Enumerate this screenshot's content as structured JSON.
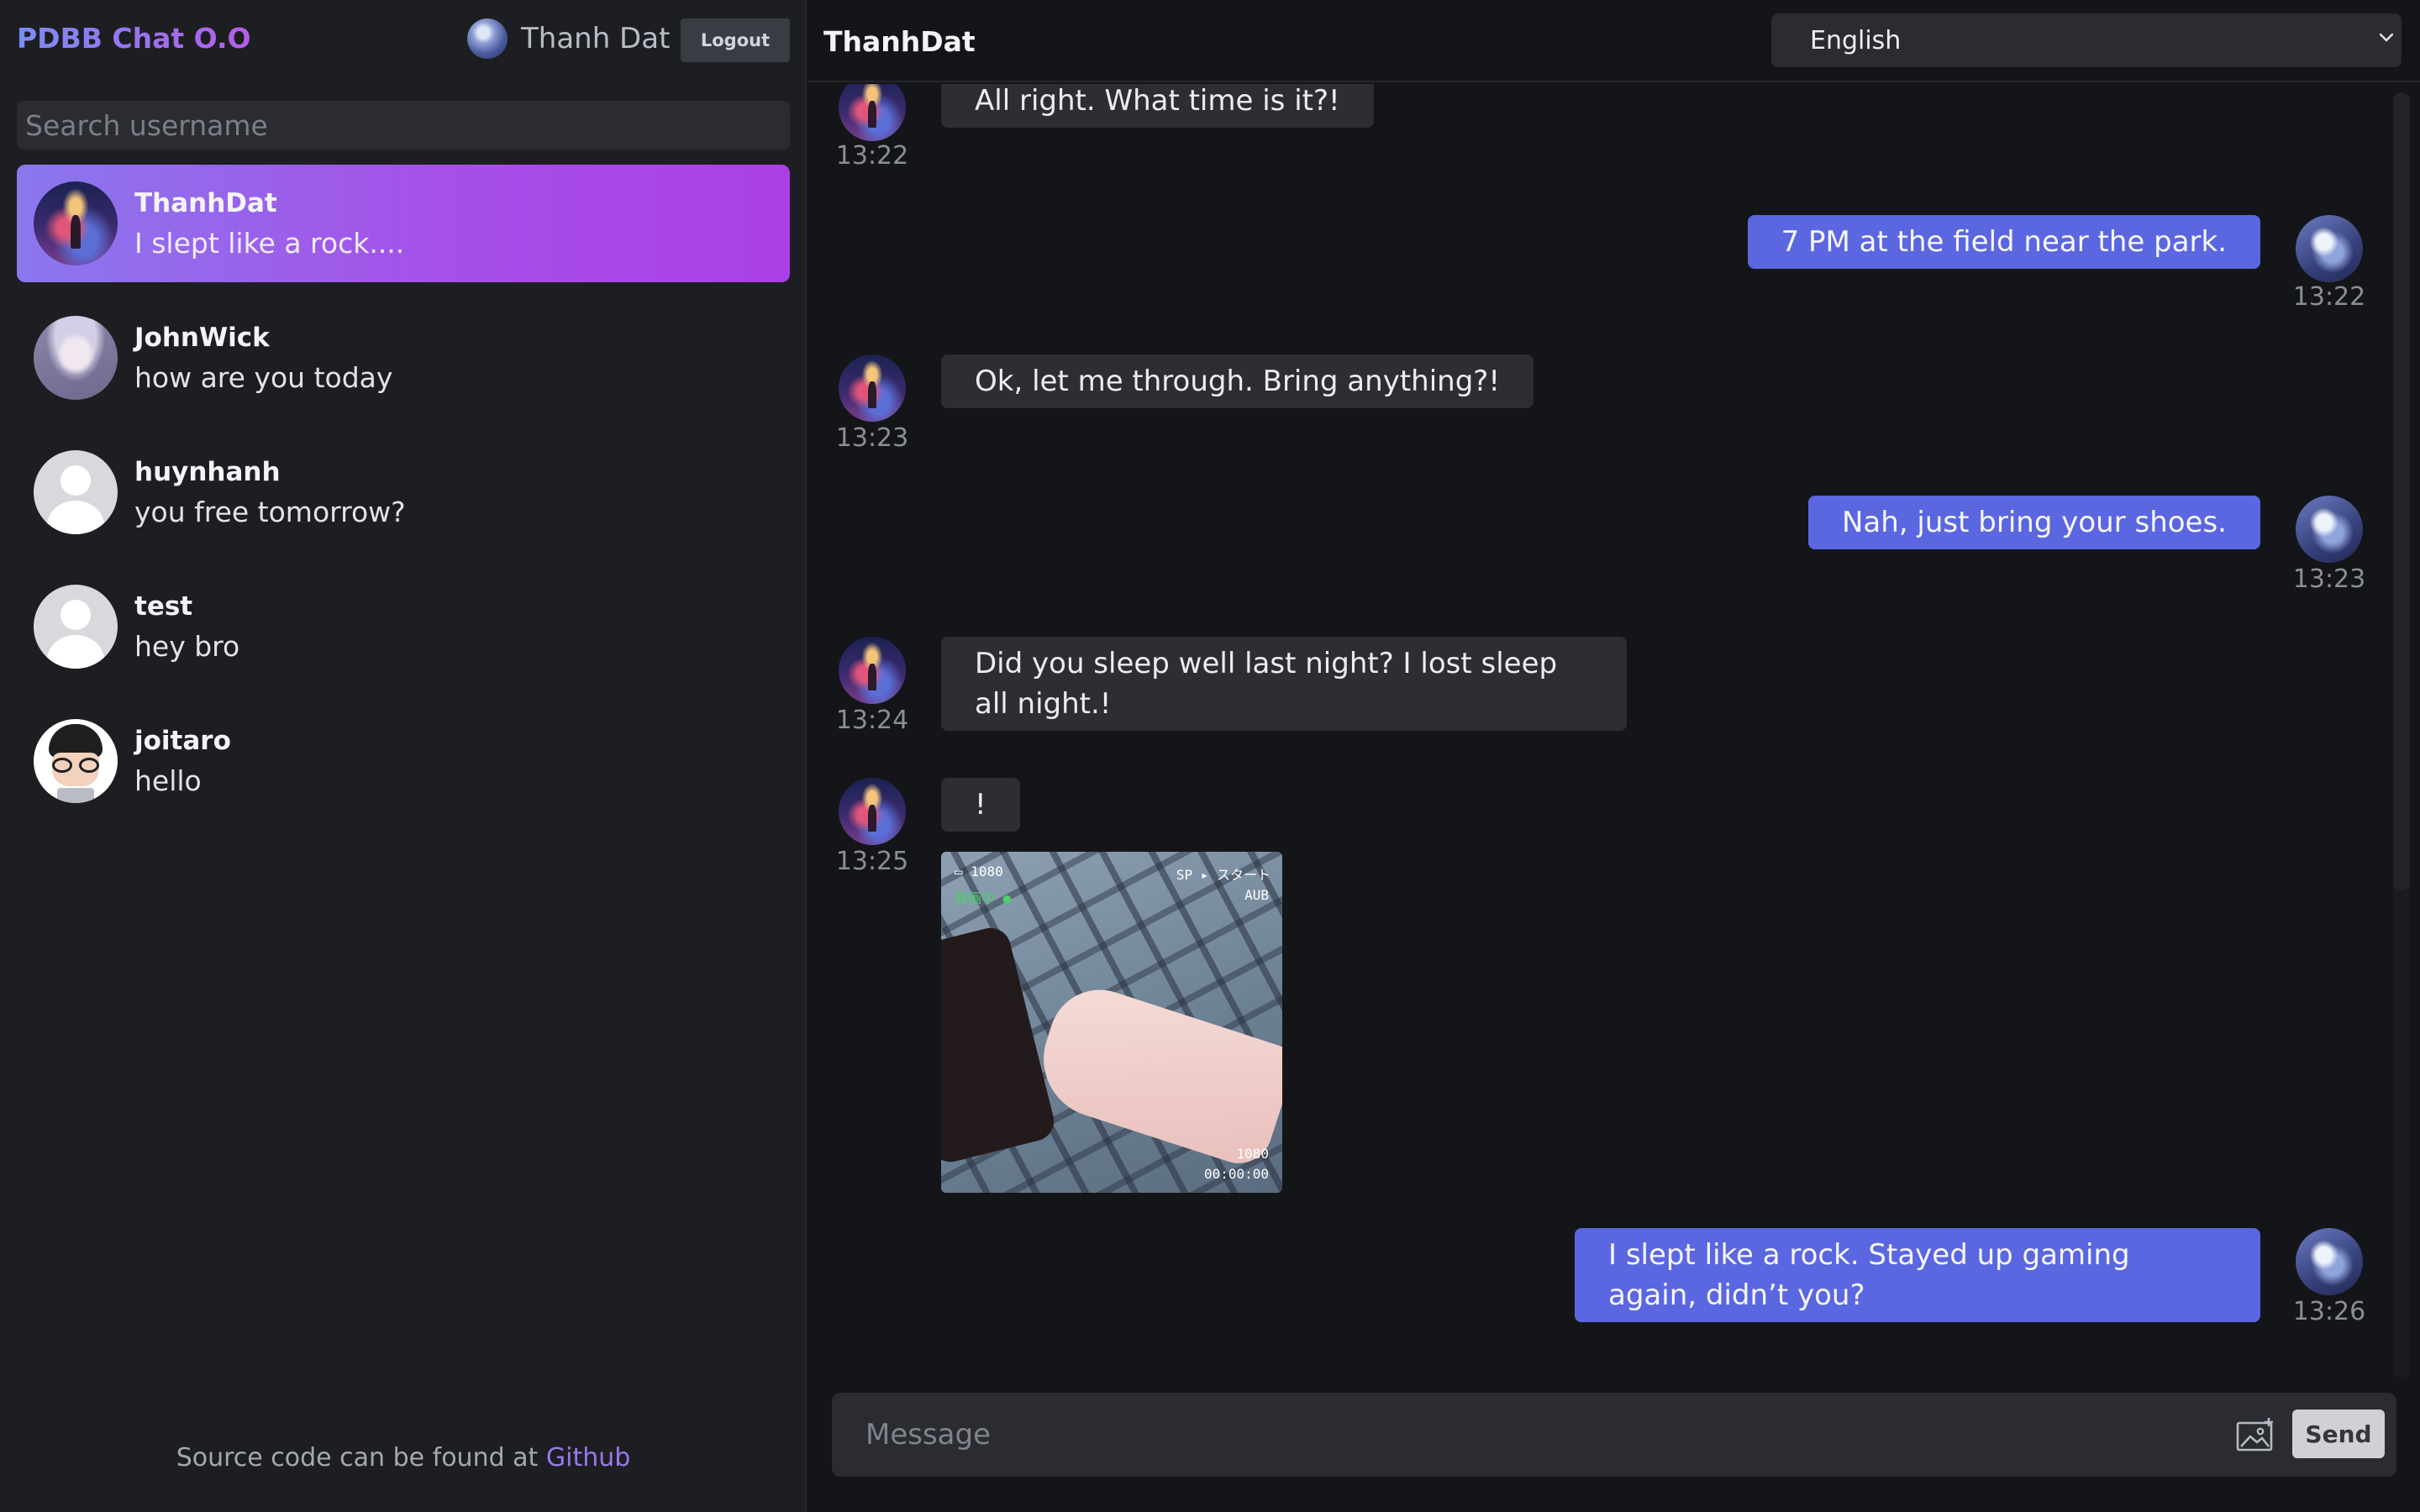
{
  "app": {
    "brand": "PDBB Chat O.O"
  },
  "current_user": {
    "name": "Thanh Dat",
    "logout_label": "Logout"
  },
  "search": {
    "placeholder": "Search username"
  },
  "contacts": [
    {
      "name": "ThanhDat",
      "preview": "I slept like a rock....",
      "avatar": "galaxy-avatar",
      "active": true
    },
    {
      "name": "JohnWick",
      "preview": "how are you today",
      "avatar": "anime-avatar",
      "active": false
    },
    {
      "name": "huynhanh",
      "preview": "you free tomorrow?",
      "avatar": "default-avatar",
      "active": false
    },
    {
      "name": "test",
      "preview": "hey bro",
      "avatar": "default-avatar",
      "active": false
    },
    {
      "name": "joitaro",
      "preview": "hello",
      "avatar": "nerd-avatar",
      "active": false
    }
  ],
  "footer": {
    "text": "Source code can be found at",
    "link_label": "Github"
  },
  "chat": {
    "title": "ThanhDat",
    "language": "English",
    "messages": [
      {
        "direction": "in",
        "text": "All right. What time is it?!",
        "time": "13:22"
      },
      {
        "direction": "out",
        "text": "7 PM at the field near the park.",
        "time": "13:22"
      },
      {
        "direction": "in",
        "text": "Ok, let me through. Bring anything?!",
        "time": "13:23"
      },
      {
        "direction": "out",
        "text": "Nah, just bring your shoes.",
        "time": "13:23"
      },
      {
        "direction": "in",
        "text": "Did you sleep well last night? I lost sleep all night.!",
        "time": "13:24"
      },
      {
        "direction": "in",
        "text": "!",
        "time": "13:25"
      },
      {
        "direction": "out",
        "text": "I slept like a rock. Stayed up gaming again, didn’t you?",
        "time": "13:26"
      }
    ],
    "photo_hud": {
      "top_left": "▭ 1080",
      "top_right": "SP ▸ スタート",
      "top_right_sub": "AUB",
      "rec": "録画中 ●",
      "bottom_right_top": "1080",
      "bottom_right": "00:00:00"
    }
  },
  "composer": {
    "placeholder": "Message",
    "send_label": "Send"
  },
  "colors": {
    "accent": "#5b67e0",
    "active_gradient_start": "#8a78ee",
    "active_gradient_end": "#ab3fe6",
    "link": "#9a78e8"
  }
}
